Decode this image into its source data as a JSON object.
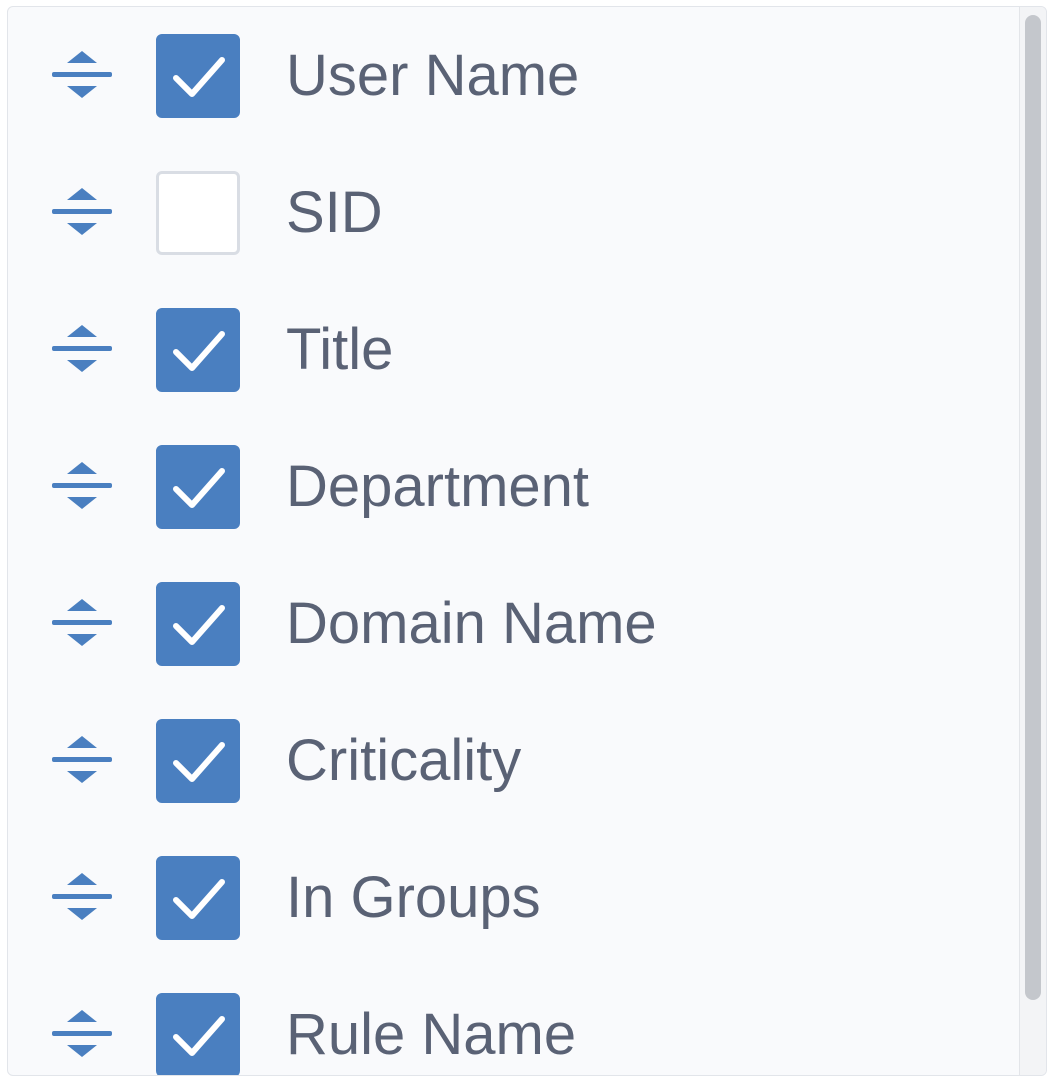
{
  "column_picker": {
    "items": [
      {
        "label": "User Name",
        "checked": true
      },
      {
        "label": "SID",
        "checked": false
      },
      {
        "label": "Title",
        "checked": true
      },
      {
        "label": "Department",
        "checked": true
      },
      {
        "label": "Domain Name",
        "checked": true
      },
      {
        "label": "Criticality",
        "checked": true
      },
      {
        "label": "In Groups",
        "checked": true
      },
      {
        "label": "Rule Name",
        "checked": true
      }
    ],
    "icons": {
      "drag": "drag-handle-icon",
      "check": "checkmark-icon"
    },
    "colors": {
      "accent": "#4a7fc0",
      "label": "#5a6275",
      "checkbox_border": "#d9dde4"
    }
  }
}
